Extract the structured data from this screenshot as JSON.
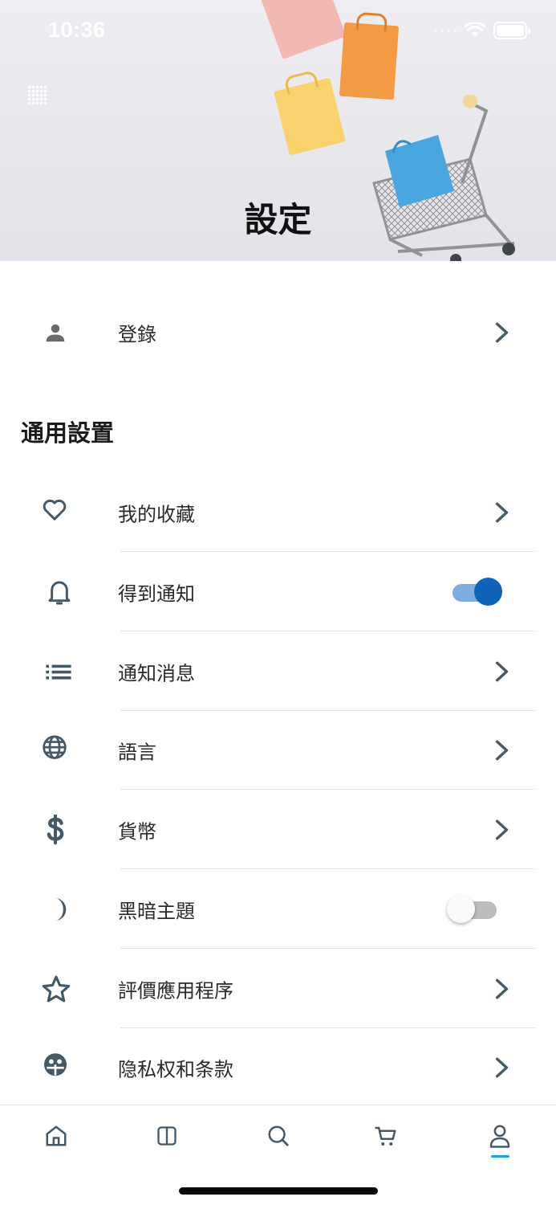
{
  "status_bar": {
    "time": "10:36"
  },
  "header": {
    "title": "設定"
  },
  "account": {
    "login_label": "登錄"
  },
  "general": {
    "section_title": "通用設置",
    "items": [
      {
        "label": "我的收藏",
        "icon": "heart-icon",
        "control": "chevron"
      },
      {
        "label": "得到通知",
        "icon": "bell-icon",
        "control": "toggle",
        "enabled": true
      },
      {
        "label": "通知消息",
        "icon": "list-icon",
        "control": "chevron"
      },
      {
        "label": "語言",
        "icon": "globe-icon",
        "control": "chevron"
      },
      {
        "label": "貨幣",
        "icon": "dollar-icon",
        "control": "chevron"
      },
      {
        "label": "黑暗主題",
        "icon": "moon-icon",
        "control": "toggle",
        "enabled": false
      },
      {
        "label": "評價應用程序",
        "icon": "star-icon",
        "control": "chevron"
      },
      {
        "label": "隐私权和条款",
        "icon": "privacy-icon",
        "control": "chevron"
      }
    ]
  },
  "bottom_nav": {
    "items": [
      "home-icon",
      "catalog-icon",
      "search-icon",
      "cart-icon",
      "profile-icon"
    ],
    "active": "profile-icon"
  },
  "colors": {
    "icon": "#445866",
    "toggle_on_knob": "#0f63b8",
    "toggle_on_track": "#7eaee0",
    "active_indicator": "#1aa3e8"
  }
}
